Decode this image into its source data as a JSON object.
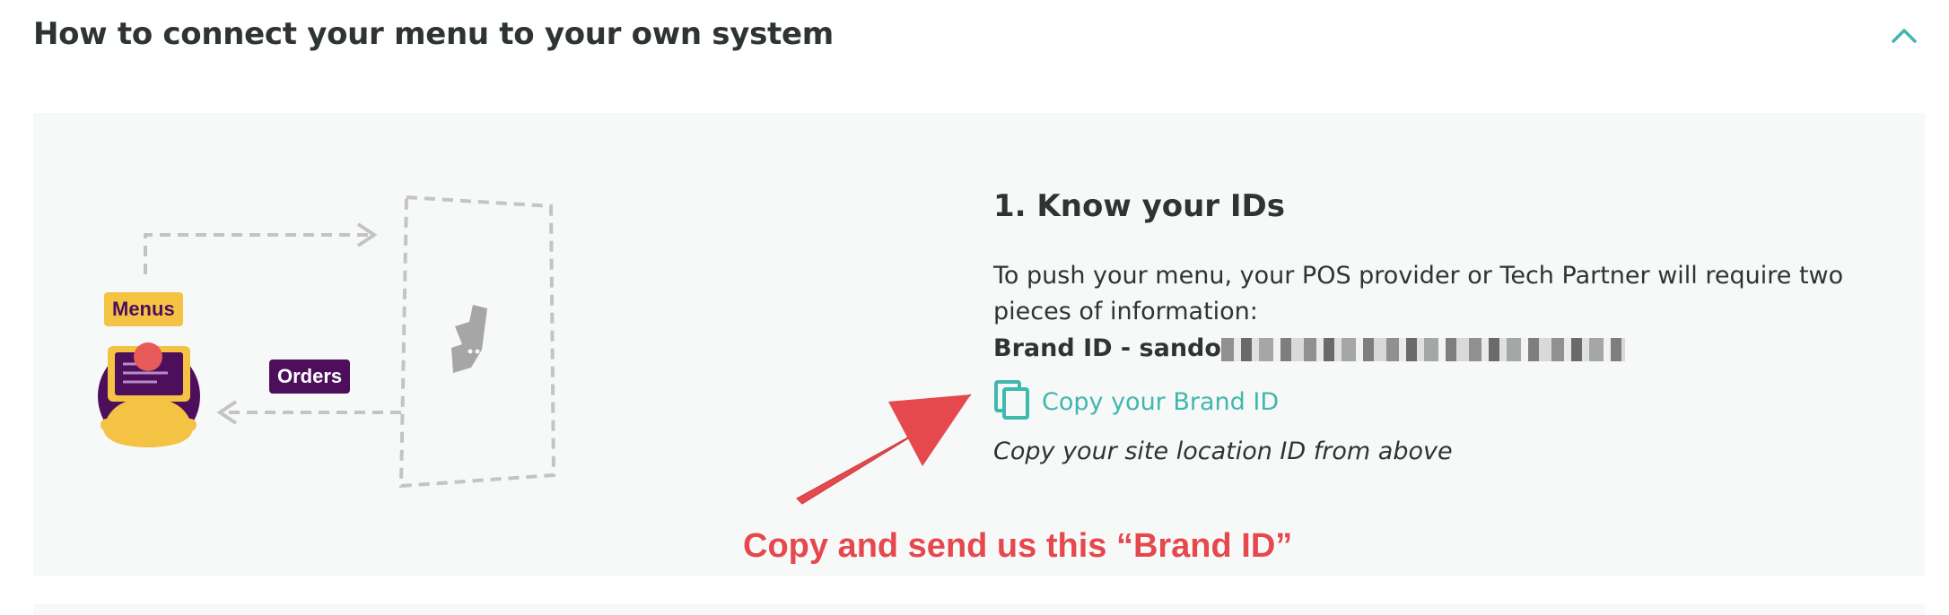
{
  "section": {
    "title": "How to connect your menu to your own system",
    "toggle_icon": "chevron-up-icon"
  },
  "illustration": {
    "menus_badge": "Menus",
    "orders_badge": "Orders",
    "colors": {
      "menus_badge_bg": "#f5c343",
      "orders_badge_bg": "#4d0f5c",
      "dashed_line": "#c4c4c4",
      "brand_logo": "#a6a6a6"
    }
  },
  "step": {
    "title": "1. Know your IDs",
    "description": "To push your menu, your POS provider or Tech Partner will require two pieces of information:",
    "brand_id_label": "Brand ID - sando",
    "copy_button_label": "Copy your Brand ID",
    "copy_icon": "copy-icon",
    "site_location_note": "Copy your site location ID from above"
  },
  "annotation": {
    "text": "Copy and send us this “Brand ID”",
    "color": "#e5484d"
  },
  "colors": {
    "accent": "#3fb8ae",
    "panel_bg": "#f7f8f8",
    "text": "#2e3333"
  }
}
